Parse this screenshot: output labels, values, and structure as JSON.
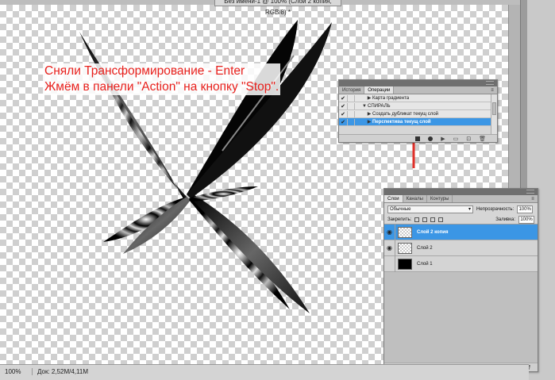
{
  "document": {
    "title": "Без имени-1 @ 100% (Слой 2 копия, RGB/8) *"
  },
  "annotation": {
    "line1": "Сняли Трансформирование - Enter",
    "line2": "Жмём в панели \"Action\" на кнопку \"Stop\".",
    "color": "#e8201c"
  },
  "status_bar": {
    "zoom": "100%",
    "doc_size": "Док: 2,52M/4,11M"
  },
  "actions_panel": {
    "tabs": [
      "История",
      "Операции"
    ],
    "active_tab": "Операции",
    "rows": [
      {
        "label": "Карта градиента",
        "checked": true
      },
      {
        "label": "СПИРАЛЬ",
        "checked": true,
        "expanded": true
      },
      {
        "label": "Создать дубликат текущ слой",
        "checked": true
      },
      {
        "label": "Перспектива текущ слой",
        "checked": true,
        "selected": true
      }
    ],
    "toolbar_icons": [
      "stop-icon",
      "record-icon",
      "play-icon",
      "new-set-icon",
      "new-action-icon",
      "trash-icon"
    ]
  },
  "layers_panel": {
    "tabs": [
      "Слои",
      "Каналы",
      "Контуры"
    ],
    "active_tab": "Слои",
    "blend_mode": "Обычные",
    "opacity_label": "Непрозрачность:",
    "opacity_value": "100%",
    "lock_label": "Закрепить:",
    "fill_label": "Заливка:",
    "fill_value": "100%",
    "layers": [
      {
        "name": "Слой 2 копия",
        "visible": true,
        "selected": true,
        "thumb": "art"
      },
      {
        "name": "Слой 2",
        "visible": true,
        "selected": false,
        "thumb": "art"
      },
      {
        "name": "Слой 1",
        "visible": false,
        "selected": false,
        "thumb": "black"
      }
    ],
    "toolbar_icons": [
      "link-icon",
      "fx-icon",
      "mask-icon",
      "adjustment-icon",
      "group-icon",
      "new-layer-icon",
      "trash-icon"
    ]
  }
}
